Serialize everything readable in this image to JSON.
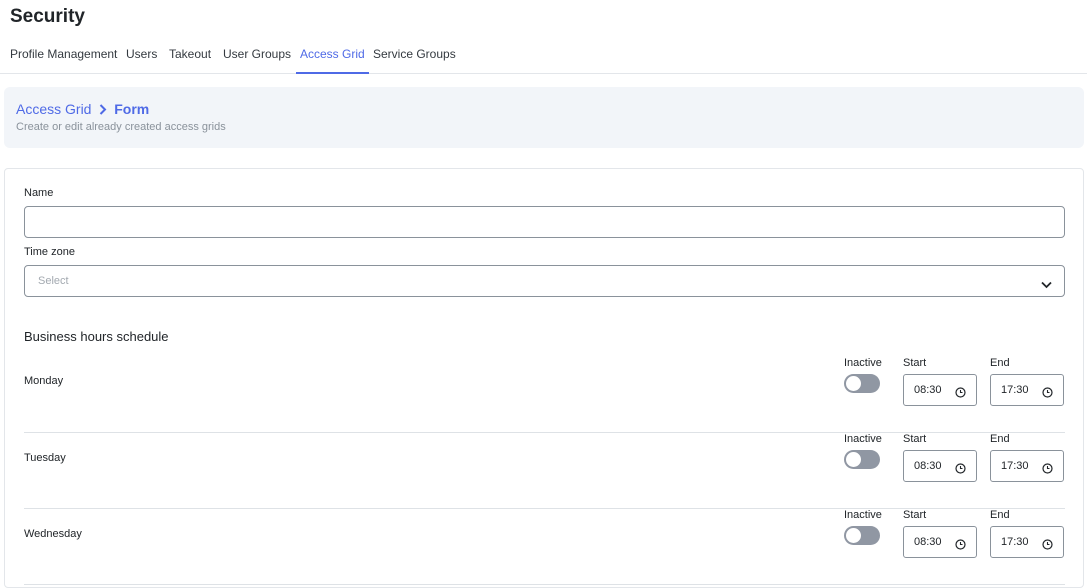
{
  "page": {
    "title": "Security"
  },
  "tabs": [
    {
      "label": "Profile Management"
    },
    {
      "label": "Users"
    },
    {
      "label": "Takeout"
    },
    {
      "label": "User Groups"
    },
    {
      "label": "Access Grid",
      "active": true
    },
    {
      "label": "Service Groups"
    }
  ],
  "header": {
    "breadcrumb": {
      "parent": "Access Grid",
      "current": "Form"
    },
    "subtitle": "Create or edit already created access grids"
  },
  "form": {
    "name_label": "Name",
    "name_value": "",
    "timezone_label": "Time zone",
    "timezone_placeholder": "Select"
  },
  "schedule": {
    "title": "Business hours schedule",
    "status_label": "Inactive",
    "start_label": "Start",
    "end_label": "End",
    "days": [
      {
        "name": "Monday",
        "start": "08:30",
        "end": "17:30",
        "active": false
      },
      {
        "name": "Tuesday",
        "start": "08:30",
        "end": "17:30",
        "active": false
      },
      {
        "name": "Wednesday",
        "start": "08:30",
        "end": "17:30",
        "active": false
      }
    ]
  },
  "colors": {
    "accent": "#4f6ae6",
    "toggle_off": "#9097a3",
    "header_bg": "#f2f5f9"
  }
}
